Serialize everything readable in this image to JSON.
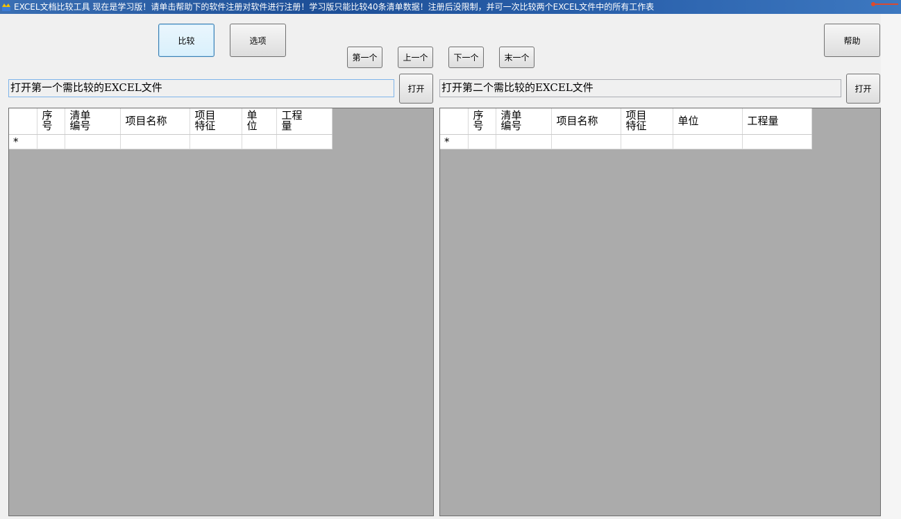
{
  "window": {
    "title": "EXCEL文档比较工具      现在是学习版！请单击帮助下的软件注册对软件进行注册！学习版只能比较40条清单数据！注册后没限制，并可一次比较两个EXCEL文件中的所有工作表"
  },
  "toolbar": {
    "compare_label": "比较",
    "options_label": "选项",
    "first_label": "第一个",
    "prev_label": "上一个",
    "next_label": "下一个",
    "last_label": "末一个",
    "help_label": "帮助"
  },
  "left": {
    "path_text": "打开第一个需比较的EXCEL文件",
    "open_label": "打开",
    "columns": [
      "序\n号",
      "清单\n编号",
      "项目名称",
      "项目\n特征",
      "单\n位",
      "工程\n量"
    ],
    "new_row_marker": "*"
  },
  "right": {
    "path_text": "打开第二个需比较的EXCEL文件",
    "open_label": "打开",
    "columns": [
      "序\n号",
      "清单\n编号",
      "项目名称",
      "项目\n特征",
      "单位",
      "工程量"
    ],
    "new_row_marker": "*"
  }
}
